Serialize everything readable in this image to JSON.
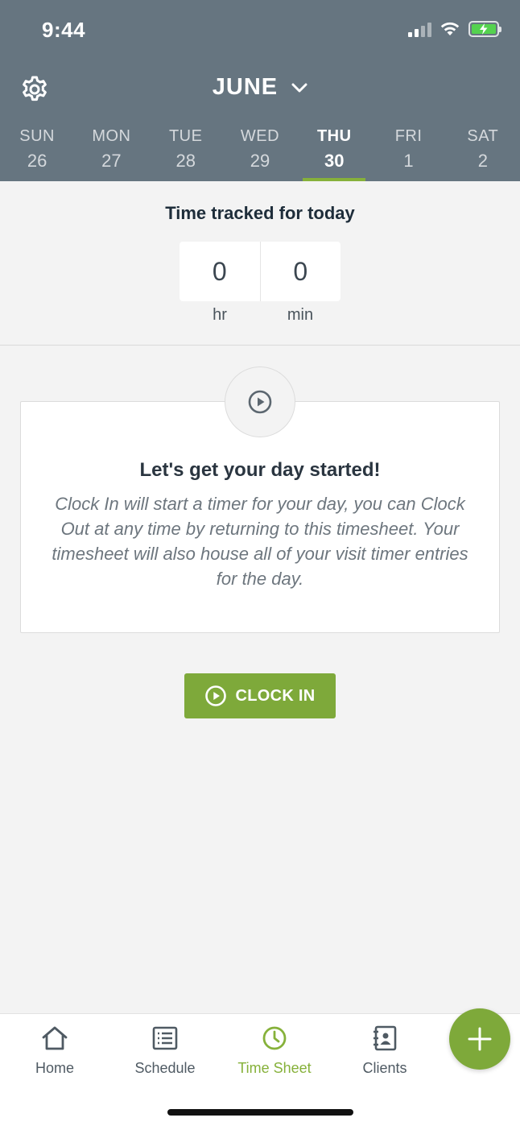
{
  "status_bar": {
    "time": "9:44"
  },
  "header": {
    "month": "JUNE",
    "days": [
      {
        "name": "SUN",
        "date": "26"
      },
      {
        "name": "MON",
        "date": "27"
      },
      {
        "name": "TUE",
        "date": "28"
      },
      {
        "name": "WED",
        "date": "29"
      },
      {
        "name": "THU",
        "date": "30",
        "active": true
      },
      {
        "name": "FRI",
        "date": "1"
      },
      {
        "name": "SAT",
        "date": "2"
      }
    ]
  },
  "tracked": {
    "title": "Time tracked for today",
    "hours": "0",
    "minutes": "0",
    "hours_label": "hr",
    "minutes_label": "min"
  },
  "card": {
    "title": "Let's get your day started!",
    "body": "Clock In will start a timer for your day, you can Clock Out at any time by returning to this timesheet. Your timesheet will also house all of your visit timer entries for the day."
  },
  "clock_in_label": "CLOCK IN",
  "nav": {
    "items": [
      {
        "label": "Home",
        "icon": "home-icon"
      },
      {
        "label": "Schedule",
        "icon": "schedule-icon"
      },
      {
        "label": "Time Sheet",
        "icon": "clock-icon",
        "active": true
      },
      {
        "label": "Clients",
        "icon": "contacts-icon"
      }
    ]
  },
  "colors": {
    "header_bg": "#667580",
    "accent": "#7ea93a",
    "background": "#f3f3f3"
  }
}
